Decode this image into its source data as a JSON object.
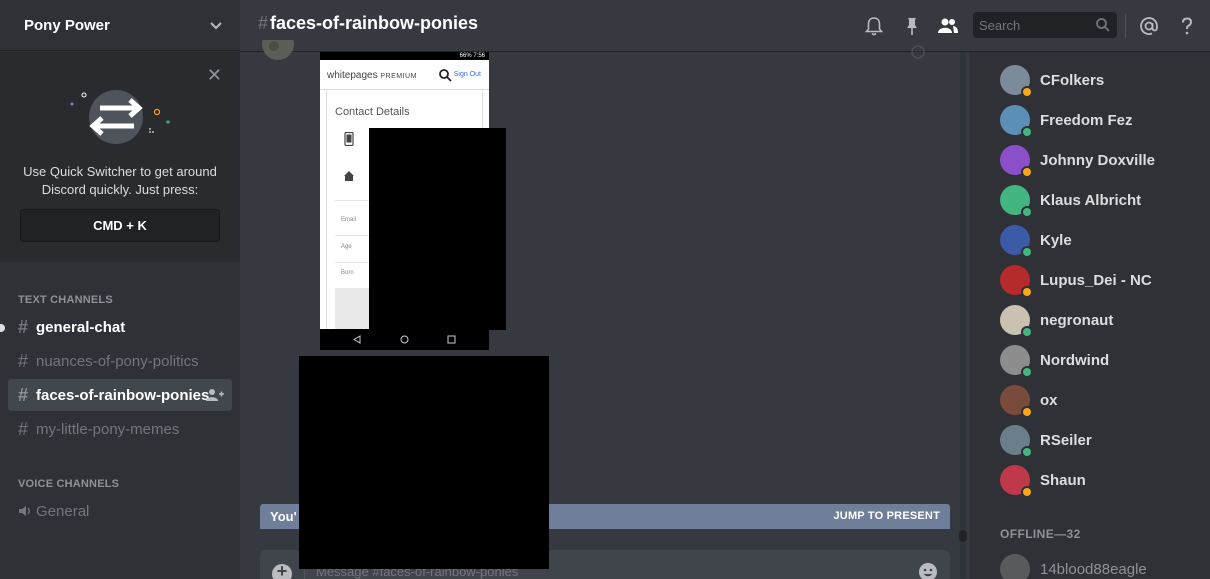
{
  "guild": {
    "name": "Pony Power"
  },
  "quick_switcher": {
    "text": "Use Quick Switcher to get around Discord quickly. Just press:",
    "shortcut": "CMD + K"
  },
  "channels": {
    "text_category": "TEXT CHANNELS",
    "voice_category": "VOICE CHANNELS",
    "text": [
      {
        "name": "general-chat",
        "state": "unread"
      },
      {
        "name": "nuances-of-pony-politics",
        "state": "muted"
      },
      {
        "name": "faces-of-rainbow-ponies",
        "state": "selected"
      },
      {
        "name": "my-little-pony-memes",
        "state": "muted"
      }
    ],
    "voice": [
      {
        "name": "General"
      }
    ]
  },
  "topbar": {
    "hash": "#",
    "channel": "faces-of-rainbow-ponies",
    "search_placeholder": "Search",
    "icons": [
      "bell-icon",
      "pin-icon",
      "members-icon",
      "search-icon",
      "mention-icon",
      "help-icon"
    ]
  },
  "message": {
    "attachment": {
      "brand": "whitepages",
      "brand_sub": "PREMIUM",
      "sign_out": "Sign Out",
      "section": "Contact Details",
      "fields": [
        "Email",
        "Age",
        "Born"
      ],
      "status_text": "66% 7:56"
    }
  },
  "jump_bar": {
    "left": "You'",
    "right": "JUMP TO PRESENT"
  },
  "composer": {
    "placeholder": "Message #faces-of-rainbow-ponies"
  },
  "members": {
    "online": [
      {
        "name": "CFolkers",
        "status": "idle",
        "color": "#7c8b99"
      },
      {
        "name": "Freedom Fez",
        "status": "online",
        "color": "#5b8fb8"
      },
      {
        "name": "Johnny Doxville",
        "status": "idle",
        "color": "#8a4fc9"
      },
      {
        "name": "Klaus Albricht",
        "status": "online",
        "color": "#43b581"
      },
      {
        "name": "Kyle",
        "status": "online",
        "color": "#3b5aa8"
      },
      {
        "name": "Lupus_Dei - NC",
        "status": "idle",
        "color": "#b52a2a"
      },
      {
        "name": "negronaut",
        "status": "online",
        "color": "#c9c2b2"
      },
      {
        "name": "Nordwind",
        "status": "online",
        "color": "#8d8d8d"
      },
      {
        "name": "ox",
        "status": "idle",
        "color": "#7a4a3a"
      },
      {
        "name": "RSeiler",
        "status": "online",
        "color": "#6b7f8a"
      },
      {
        "name": "Shaun",
        "status": "idle",
        "color": "#c0394a"
      }
    ],
    "offline_label": "OFFLINE—32",
    "offline": [
      {
        "name": "14blood88eagle",
        "color": "#777"
      }
    ]
  },
  "colors": {
    "online": "#43b581",
    "idle": "#faa61a",
    "sidebar": "#2f3136",
    "chat": "#36393f"
  }
}
